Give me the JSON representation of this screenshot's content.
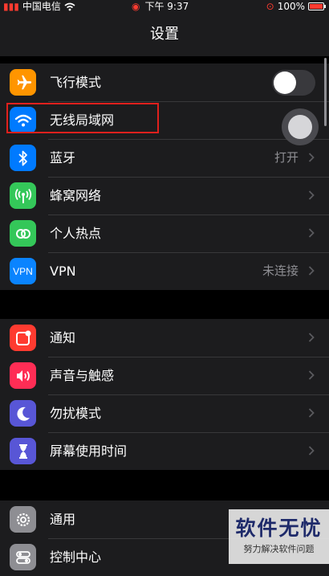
{
  "status_bar": {
    "carrier": "中国电信",
    "time": "下午 9:37",
    "battery": "100%"
  },
  "header": {
    "title": "设置"
  },
  "groups": [
    {
      "rows": [
        {
          "label": "飞行模式",
          "icon": "airplane-icon",
          "color": "#ff9500",
          "toggle": "off"
        },
        {
          "label": "无线局域网",
          "icon": "wifi-icon",
          "color": "#007aff"
        },
        {
          "label": "蓝牙",
          "icon": "bluetooth-icon",
          "color": "#007aff",
          "value": "打开"
        },
        {
          "label": "蜂窝网络",
          "icon": "cellular-icon",
          "color": "#34c759"
        },
        {
          "label": "个人热点",
          "icon": "hotspot-icon",
          "color": "#34c759"
        },
        {
          "label": "VPN",
          "icon": "vpn-icon",
          "icon_text": "VPN",
          "color": "#0a84ff",
          "value": "未连接"
        }
      ]
    },
    {
      "rows": [
        {
          "label": "通知",
          "icon": "notifications-icon",
          "color": "#ff3b30"
        },
        {
          "label": "声音与触感",
          "icon": "sound-icon",
          "color": "#ff2d55"
        },
        {
          "label": "勿扰模式",
          "icon": "moon-icon",
          "color": "#5856d6"
        },
        {
          "label": "屏幕使用时间",
          "icon": "hourglass-icon",
          "color": "#5856d6"
        }
      ]
    },
    {
      "rows": [
        {
          "label": "通用",
          "icon": "gear-icon",
          "color": "#8e8e93"
        },
        {
          "label": "控制中心",
          "icon": "control-center-icon",
          "color": "#8e8e93"
        }
      ]
    }
  ],
  "watermark": {
    "title": "软件无忧",
    "subtitle": "努力解决软件问题"
  }
}
